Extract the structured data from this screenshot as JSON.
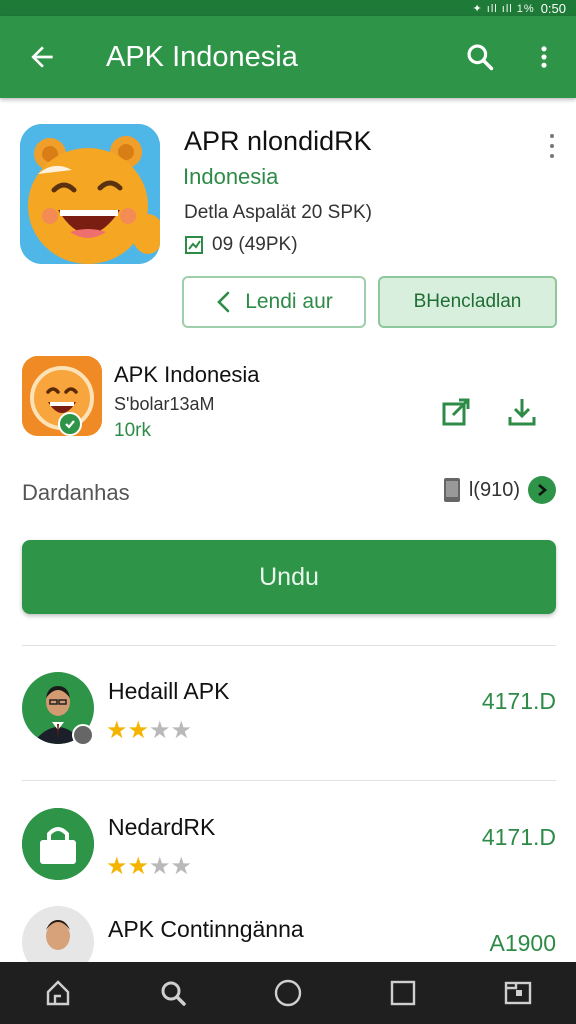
{
  "status_bar": {
    "time": "0:50",
    "icons": "✦ ıll ıll 1%"
  },
  "app_bar": {
    "title": "APK Indonesia",
    "back_icon": "arrow-left-icon",
    "search_icon": "search-icon",
    "more_icon": "more-vert-icon"
  },
  "hero": {
    "app_name": "APR nlondidRK",
    "developer": "Indonesia",
    "meta": "Detla Aspalät 20 SPK)",
    "size": "09 (49PK)",
    "size_icon": "chart-icon",
    "btn_outline_label": "Lendi aur",
    "btn_tonal_label": "BHencladlan"
  },
  "app_row": {
    "name": "APK Indonesia",
    "subtitle": "S'bolar13aM",
    "size": "10rk",
    "share_icon": "open-external-icon",
    "download_icon": "download-icon"
  },
  "details": {
    "label": "Dardanhas",
    "value": "l(910)",
    "phone_icon": "phone-icon",
    "check_icon": "check-circle-icon"
  },
  "primary_button": {
    "label": "Undu"
  },
  "list": [
    {
      "title": "Hedaill APK",
      "rating": 2,
      "max_rating": 4,
      "price": "4171.D",
      "avatar": "person-avatar"
    },
    {
      "title": "NedardRK",
      "rating": 2,
      "max_rating": 4,
      "price": "4171.D",
      "avatar": "lock-avatar"
    },
    {
      "title": "APK Continngänna",
      "rating": 0,
      "max_rating": 0,
      "price": "A1900",
      "avatar": "person-avatar"
    }
  ],
  "nav_bar": {
    "icons": [
      "home-icon",
      "search-icon",
      "circle-home-icon",
      "square-recents-icon",
      "tab-icon"
    ]
  },
  "colors": {
    "primary": "#2e9447",
    "dark_primary": "#1e7a37",
    "star_on": "#f4b400",
    "star_off": "#b9b9b9"
  }
}
